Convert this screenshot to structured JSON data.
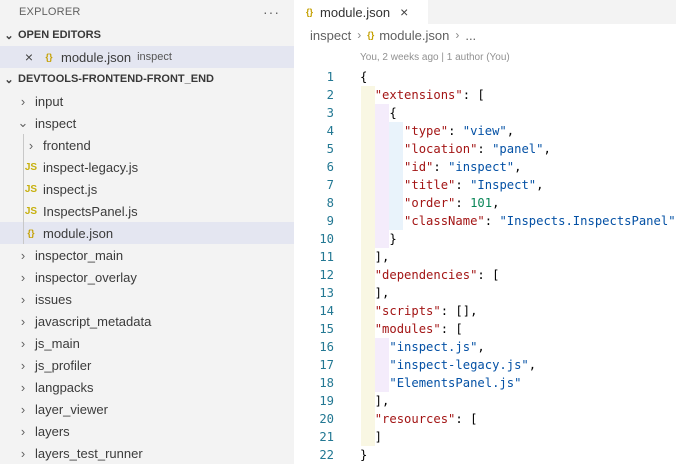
{
  "explorer": {
    "title": "EXPLORER",
    "more": "···",
    "open_editors": {
      "label": "OPEN EDITORS",
      "items": [
        {
          "name": "module.json",
          "desc": "inspect"
        }
      ]
    },
    "workspace": {
      "label": "DEVTOOLS-FRONTEND-FRONT_END",
      "tree": [
        {
          "label": "input",
          "type": "folder",
          "expanded": false,
          "depth": 0
        },
        {
          "label": "inspect",
          "type": "folder",
          "expanded": true,
          "depth": 0
        },
        {
          "label": "frontend",
          "type": "folder",
          "expanded": false,
          "depth": 1
        },
        {
          "label": "inspect-legacy.js",
          "type": "js",
          "depth": 1
        },
        {
          "label": "inspect.js",
          "type": "js",
          "depth": 1
        },
        {
          "label": "InspectsPanel.js",
          "type": "js",
          "depth": 1
        },
        {
          "label": "module.json",
          "type": "json",
          "depth": 1,
          "selected": true
        },
        {
          "label": "inspector_main",
          "type": "folder",
          "expanded": false,
          "depth": 0
        },
        {
          "label": "inspector_overlay",
          "type": "folder",
          "expanded": false,
          "depth": 0
        },
        {
          "label": "issues",
          "type": "folder",
          "expanded": false,
          "depth": 0
        },
        {
          "label": "javascript_metadata",
          "type": "folder",
          "expanded": false,
          "depth": 0
        },
        {
          "label": "js_main",
          "type": "folder",
          "expanded": false,
          "depth": 0
        },
        {
          "label": "js_profiler",
          "type": "folder",
          "expanded": false,
          "depth": 0
        },
        {
          "label": "langpacks",
          "type": "folder",
          "expanded": false,
          "depth": 0
        },
        {
          "label": "layer_viewer",
          "type": "folder",
          "expanded": false,
          "depth": 0
        },
        {
          "label": "layers",
          "type": "folder",
          "expanded": false,
          "depth": 0
        },
        {
          "label": "layers_test_runner",
          "type": "folder",
          "expanded": false,
          "depth": 0
        }
      ]
    }
  },
  "editor": {
    "tab": {
      "label": "module.json",
      "icon": "{}"
    },
    "breadcrumb": [
      "inspect",
      "module.json",
      "..."
    ],
    "codelens": "You, 2 weeks ago | 1 author (You)",
    "colors": {
      "key": "#a31515",
      "string": "#0451a5",
      "number": "#098658",
      "line_number": "#237893"
    },
    "lines": [
      [
        [
          "p",
          "{"
        ]
      ],
      [
        [
          "p",
          "  "
        ],
        [
          "k",
          "\"extensions\""
        ],
        [
          "p",
          ": ["
        ]
      ],
      [
        [
          "p",
          "    {"
        ]
      ],
      [
        [
          "p",
          "      "
        ],
        [
          "k",
          "\"type\""
        ],
        [
          "p",
          ": "
        ],
        [
          "s",
          "\"view\""
        ],
        [
          "p",
          ","
        ]
      ],
      [
        [
          "p",
          "      "
        ],
        [
          "k",
          "\"location\""
        ],
        [
          "p",
          ": "
        ],
        [
          "s",
          "\"panel\""
        ],
        [
          "p",
          ","
        ]
      ],
      [
        [
          "p",
          "      "
        ],
        [
          "k",
          "\"id\""
        ],
        [
          "p",
          ": "
        ],
        [
          "s",
          "\"inspect\""
        ],
        [
          "p",
          ","
        ]
      ],
      [
        [
          "p",
          "      "
        ],
        [
          "k",
          "\"title\""
        ],
        [
          "p",
          ": "
        ],
        [
          "s",
          "\"Inspect\""
        ],
        [
          "p",
          ","
        ]
      ],
      [
        [
          "p",
          "      "
        ],
        [
          "k",
          "\"order\""
        ],
        [
          "p",
          ": "
        ],
        [
          "n",
          "101"
        ],
        [
          "p",
          ","
        ]
      ],
      [
        [
          "p",
          "      "
        ],
        [
          "k",
          "\"className\""
        ],
        [
          "p",
          ": "
        ],
        [
          "s",
          "\"Inspects.InspectsPanel\""
        ]
      ],
      [
        [
          "p",
          "    }"
        ]
      ],
      [
        [
          "p",
          "  ],"
        ]
      ],
      [
        [
          "p",
          "  "
        ],
        [
          "k",
          "\"dependencies\""
        ],
        [
          "p",
          ": ["
        ]
      ],
      [
        [
          "p",
          "  ],"
        ]
      ],
      [
        [
          "p",
          "  "
        ],
        [
          "k",
          "\"scripts\""
        ],
        [
          "p",
          ": [],"
        ]
      ],
      [
        [
          "p",
          "  "
        ],
        [
          "k",
          "\"modules\""
        ],
        [
          "p",
          ": ["
        ]
      ],
      [
        [
          "p",
          "    "
        ],
        [
          "s",
          "\"inspect.js\""
        ],
        [
          "p",
          ","
        ]
      ],
      [
        [
          "p",
          "    "
        ],
        [
          "s",
          "\"inspect-legacy.js\""
        ],
        [
          "p",
          ","
        ]
      ],
      [
        [
          "p",
          "    "
        ],
        [
          "s",
          "\"ElementsPanel.js\""
        ]
      ],
      [
        [
          "p",
          "  ],"
        ]
      ],
      [
        [
          "p",
          "  "
        ],
        [
          "k",
          "\"resources\""
        ],
        [
          "p",
          ": ["
        ]
      ],
      [
        [
          "p",
          "  ]"
        ]
      ],
      [
        [
          "p",
          "}"
        ]
      ]
    ],
    "line_numbers": [
      "1",
      "2",
      "3",
      "4",
      "5",
      "6",
      "7",
      "8",
      "9",
      "10",
      "11",
      "12",
      "13",
      "14",
      "15",
      "16",
      "17",
      "18",
      "19",
      "20",
      "21",
      "22"
    ]
  }
}
